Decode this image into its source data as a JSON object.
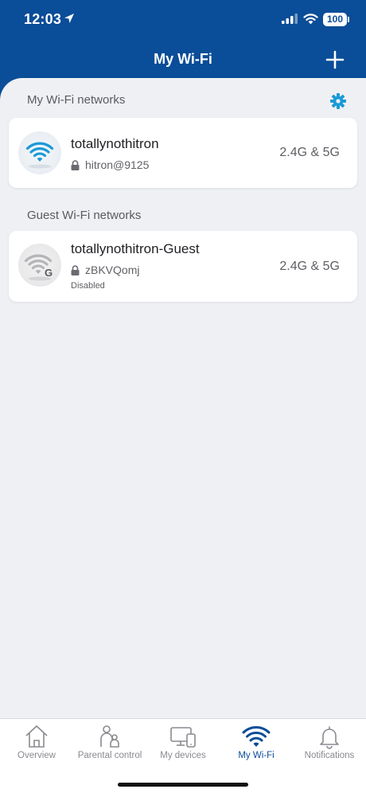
{
  "status_bar": {
    "time": "12:03",
    "battery": "100",
    "icons": [
      "location-arrow-icon",
      "cellular-signal-icon",
      "wifi-icon",
      "battery-icon"
    ]
  },
  "header": {
    "title": "My Wi-Fi",
    "add_icon": "plus-icon",
    "background_color": "#0a4d98"
  },
  "sections": {
    "my_networks": {
      "title": "My Wi-Fi networks",
      "settings_icon": "gear-icon",
      "networks": [
        {
          "name": "totallynothitron",
          "password": "hitron@9125",
          "band": "2.4G & 5G",
          "icon": "wifi-icon"
        }
      ]
    },
    "guest_networks": {
      "title": "Guest Wi-Fi networks",
      "networks": [
        {
          "name": "totallynothitron-Guest",
          "password": "zBKVQomj",
          "band": "2.4G & 5G",
          "status": "Disabled",
          "icon": "guest-wifi-icon"
        }
      ]
    }
  },
  "tabbar": {
    "tabs": [
      {
        "label": "Overview",
        "icon": "home-icon"
      },
      {
        "label": "Parental control",
        "icon": "parental-control-icon"
      },
      {
        "label": "My devices",
        "icon": "devices-icon"
      },
      {
        "label": "My Wi-Fi",
        "icon": "wifi-icon",
        "active": true
      },
      {
        "label": "Notifications",
        "icon": "bell-icon"
      }
    ],
    "active_color": "#0a4d98",
    "inactive_color": "#8a8a90"
  },
  "colors": {
    "accent": "#1a9ad6",
    "background": "#eff0f4"
  }
}
